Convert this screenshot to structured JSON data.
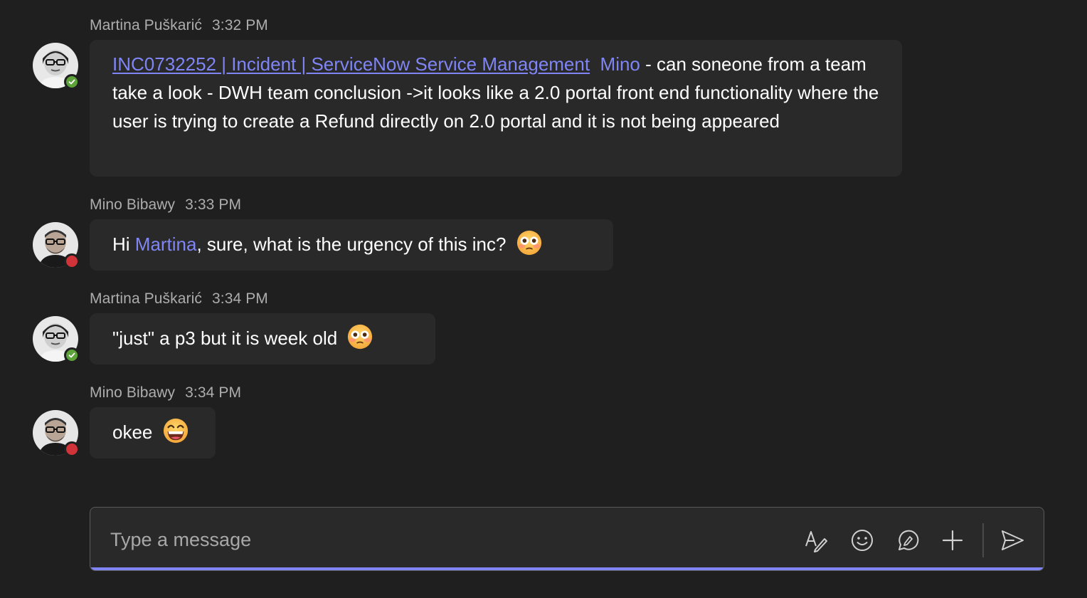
{
  "messages": [
    {
      "sender": "Martina Puškarić",
      "time": "3:32 PM",
      "presence": "available",
      "link_text": "INC0732252 | Incident | ServiceNow Service Management",
      "mention": "Mino",
      "text": " - can soneone from a team take a look - DWH team conclusion ->it looks like a 2.0 portal front end functionality where the user is trying to create a Refund directly on 2.0 portal and it is not being appeared"
    },
    {
      "sender": "Mino Bibawy",
      "time": "3:33 PM",
      "presence": "busy",
      "prefix": "Hi ",
      "mention": "Martina",
      "text": ", sure, what is the urgency of this inc?",
      "emoji": "flushed-face-emoji"
    },
    {
      "sender": "Martina Puškarić",
      "time": "3:34 PM",
      "presence": "available",
      "text": "\"just\" a p3 but it is week old",
      "emoji": "flushed-face-emoji"
    },
    {
      "sender": "Mino Bibawy",
      "time": "3:34 PM",
      "presence": "busy",
      "text": "okee",
      "emoji": "grinning-face-emoji"
    }
  ],
  "composer": {
    "placeholder": "Type a message",
    "tools": [
      "format-icon",
      "emoji-icon",
      "loop-component-icon",
      "attach-plus-icon",
      "send-icon"
    ]
  },
  "colors": {
    "background": "#1f1f1f",
    "bubble": "#292929",
    "accent": "#7f85f5",
    "meta": "#adadad",
    "available": "#5ea33a",
    "busy": "#d13438"
  }
}
